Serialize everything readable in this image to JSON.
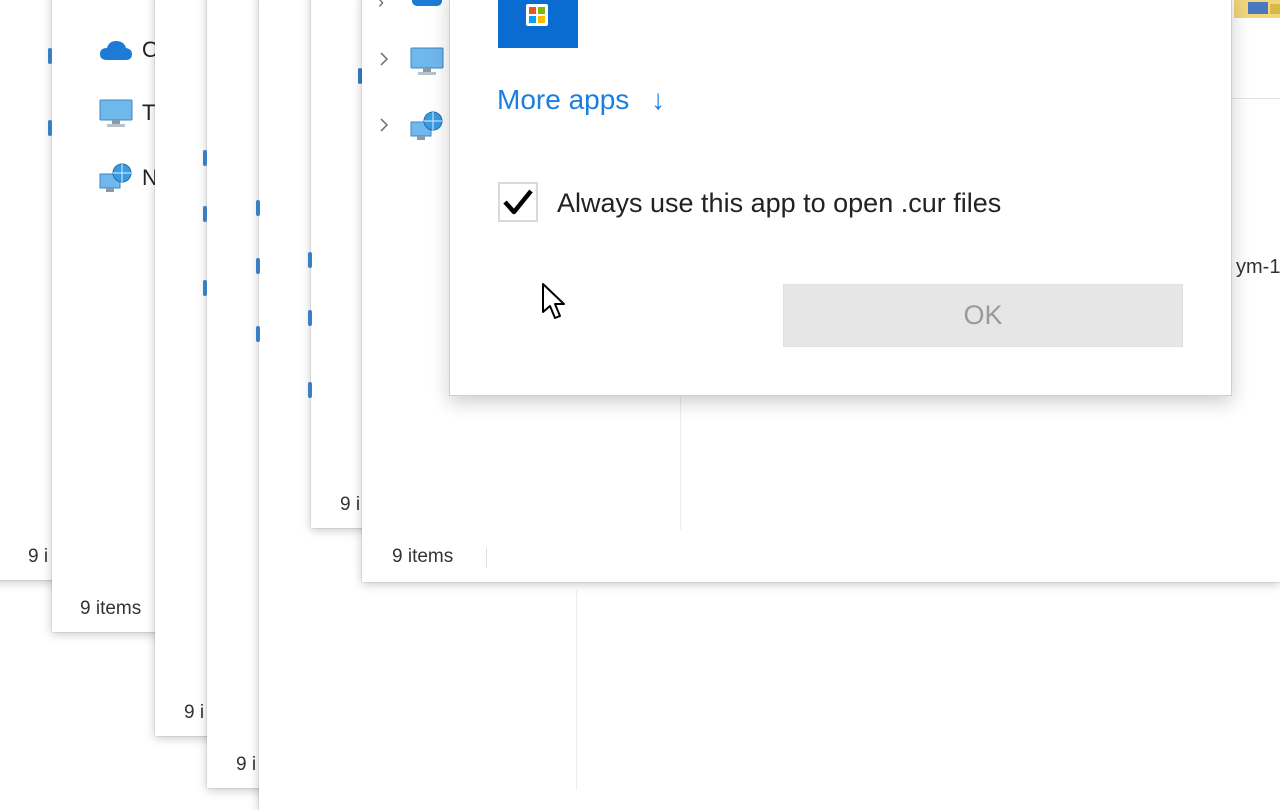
{
  "dialog": {
    "more_apps_label": "More apps",
    "more_apps_arrow": "↓",
    "checkbox_label": "Always use this app to open .cur files",
    "checkbox_checked": true,
    "ok_label": "OK"
  },
  "background_windows": {
    "status_texts": [
      "9 i",
      "9 items",
      "9 i",
      "9 i",
      "9 i",
      "9 items"
    ],
    "nav_labels": [
      "O",
      "T",
      "N"
    ],
    "right_edge_text": "ym-1"
  },
  "colors": {
    "accent": "#1a7fe0",
    "store_tile": "#0a6bd1",
    "button_disabled_bg": "#e6e6e6",
    "button_disabled_text": "#9a9a9a"
  },
  "icons": [
    "onedrive-icon",
    "this-pc-icon",
    "network-icon",
    "microsoft-store-icon",
    "chevron-right-icon",
    "checkmark-icon",
    "mouse-pointer-icon"
  ]
}
